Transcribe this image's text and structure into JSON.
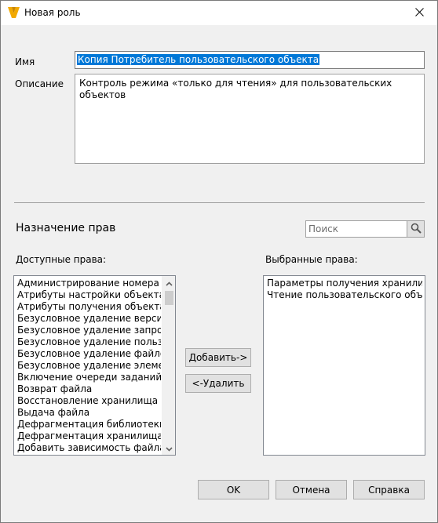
{
  "window": {
    "title": "Новая роль",
    "close_glyph": "✕"
  },
  "form": {
    "name_label": "Имя",
    "name_value": "Копия Потребитель пользовательского объекта",
    "description_label": "Описание",
    "description_value": "Контроль режима «только для чтения» для пользовательских объектов"
  },
  "rights": {
    "section_title": "Назначение прав",
    "search_placeholder": "Поиск",
    "available_label": "Доступные права:",
    "selected_label": "Выбранные права:",
    "available_items": [
      "Администрирование номера файла",
      "Атрибуты настройки объекта",
      "Атрибуты получения объекта",
      "Безусловное удаление версии файла",
      "Безусловное удаление запросов на",
      "Безусловное удаление пользователей",
      "Безусловное удаление файлов",
      "Безусловное удаление элемента",
      "Включение очереди заданий",
      "Возврат файла",
      "Восстановление хранилища",
      "Выдача файла",
      "Дефрагментация библиотеки",
      "Дефрагментация хранилища",
      "Добавить зависимость файла"
    ],
    "selected_items": [
      "Параметры получения хранилища",
      "Чтение пользовательского объекта"
    ],
    "add_button": "Добавить->",
    "remove_button": "<-Удалить"
  },
  "footer": {
    "ok": "OK",
    "cancel": "Отмена",
    "help": "Справка"
  },
  "icons": {
    "app": "vault-logo-icon",
    "search": "search-icon",
    "close": "close-icon"
  },
  "colors": {
    "selection": "#0078d7",
    "app_icon": "#f2a900"
  }
}
